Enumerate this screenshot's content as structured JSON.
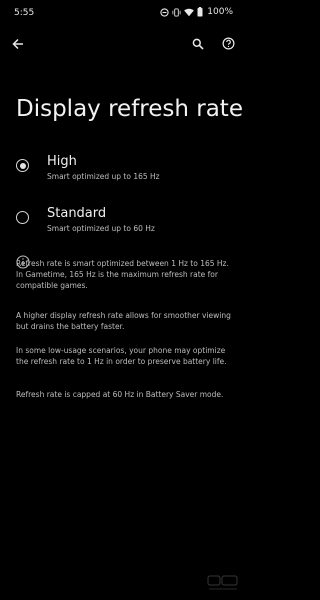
{
  "status_bar": {
    "time": "5:55",
    "battery": "100%"
  },
  "toolbar": {
    "back_icon": "arrow-back-icon",
    "search_icon": "search-icon",
    "help_icon": "help-icon"
  },
  "page": {
    "title": "Display refresh rate"
  },
  "options": [
    {
      "label": "High",
      "summary": "Smart optimized up to 165 Hz",
      "selected": true
    },
    {
      "label": "Standard",
      "summary": "Smart optimized up to 60 Hz",
      "selected": false
    }
  ],
  "info": {
    "icon": "info-icon",
    "paragraphs": [
      "Refresh rate is smart optimized between 1 Hz to 165 Hz. In Gametime, 165 Hz is the maximum refresh rate for compatible games.",
      "A higher display refresh rate allows for smoother viewing but drains the battery faster.",
      "In some low-usage scenarios, your phone may optimize the refresh rate to 1 Hz in order to preserve battery life.",
      "Refresh rate is capped at 60 Hz in Battery Saver mode."
    ]
  },
  "colors": {
    "background": "#000000",
    "text_primary": "#f0f0f0",
    "text_secondary": "#bdbdbd"
  }
}
